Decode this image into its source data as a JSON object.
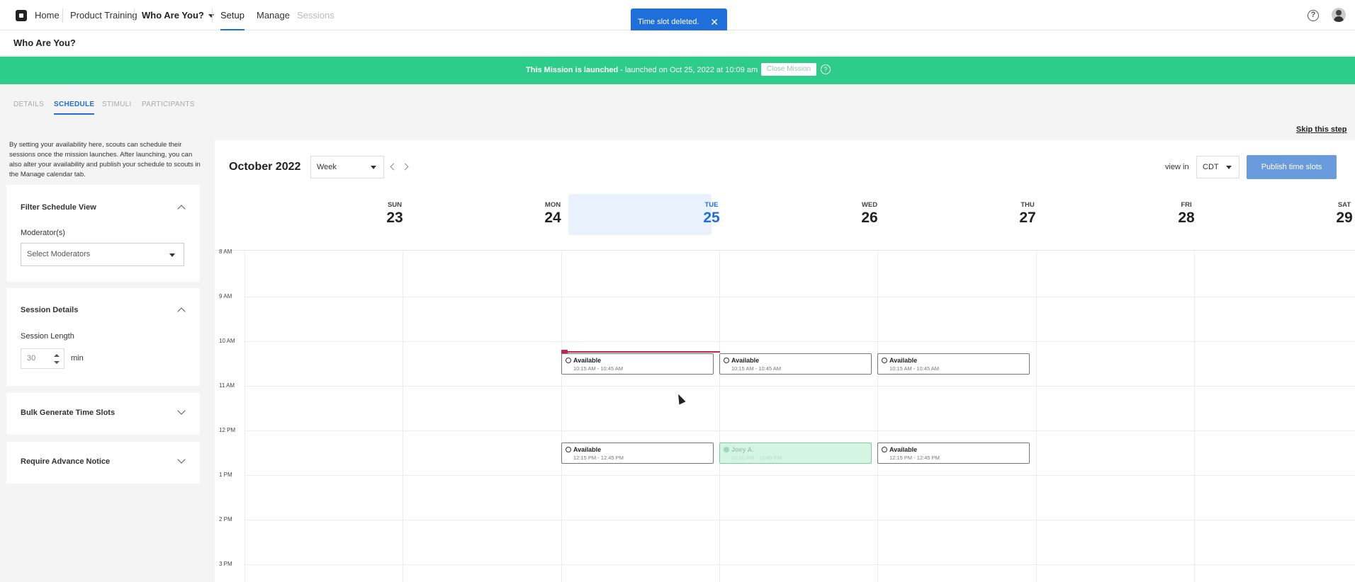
{
  "nav": {
    "home": "Home",
    "product_training": "Product Training",
    "project": "Who Are You?",
    "setup": "Setup",
    "manage": "Manage",
    "sessions": "Sessions",
    "help_icon": "help-icon",
    "avatar_icon": "user-avatar"
  },
  "toast": {
    "message": "Time slot deleted.",
    "close": "✕"
  },
  "page": {
    "title": "Who Are You?"
  },
  "banner": {
    "launched_label": "This Mission is launched",
    "launched_detail": " - launched on Oct 25, 2022 at 10:09 am",
    "close_mission": "Close Mission",
    "help": "?",
    "color": "#2ecc8a"
  },
  "tabs": [
    {
      "label": "DETAILS"
    },
    {
      "label": "SCHEDULE"
    },
    {
      "label": "STIMULI"
    },
    {
      "label": "PARTICIPANTS"
    }
  ],
  "intro": "By setting your availability here, scouts can schedule their sessions once the mission launches. After launching, you can also alter your availability and publish your schedule to scouts in the Manage calendar tab.",
  "filter": {
    "title": "Filter Schedule View",
    "moderator_label": "Moderator(s)",
    "moderator_placeholder": "Select Moderators"
  },
  "session": {
    "title": "Session Details",
    "length_label": "Session Length",
    "length_value": "30",
    "length_unit": "min"
  },
  "bulk": {
    "title": "Bulk Generate Time Slots"
  },
  "advance": {
    "title": "Require Advance Notice"
  },
  "skip": "Skip this step",
  "calendar": {
    "month": "October 2022",
    "view": "Week",
    "view_in": "view in",
    "timezone": "CDT",
    "publish": "Publish time slots",
    "accent": "#1e6fd9",
    "days": [
      {
        "dow": "SUN",
        "num": "23"
      },
      {
        "dow": "MON",
        "num": "24"
      },
      {
        "dow": "TUE",
        "num": "25"
      },
      {
        "dow": "WED",
        "num": "26"
      },
      {
        "dow": "THU",
        "num": "27"
      },
      {
        "dow": "FRI",
        "num": "28"
      },
      {
        "dow": "SAT",
        "num": "29"
      }
    ],
    "hours": [
      "8 AM",
      "9 AM",
      "10 AM",
      "11 AM",
      "12 PM",
      "1 PM",
      "2 PM",
      "3 PM"
    ],
    "slots": [
      {
        "title": "Available",
        "time": "10:15 AM - 10:45 AM"
      },
      {
        "title": "Available",
        "time": "10:15 AM - 10:45 AM"
      },
      {
        "title": "Available",
        "time": "10:15 AM - 10:45 AM"
      },
      {
        "title": "Available",
        "time": "12:15 PM - 12:45 PM"
      },
      {
        "title": "Joey A.",
        "time": "12:15 PM - 12:45 PM"
      },
      {
        "title": "Available",
        "time": "12:15 PM - 12:45 PM"
      }
    ]
  }
}
